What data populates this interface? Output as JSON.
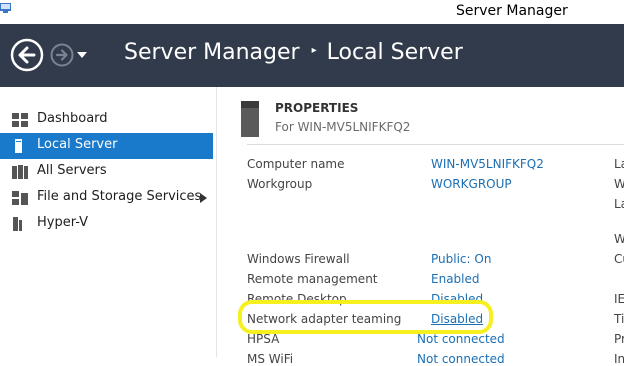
{
  "window": {
    "title": "Server Manager"
  },
  "header": {
    "breadcrumb_root": "Server Manager",
    "breadcrumb_separator": "▸",
    "breadcrumb_current": "Local Server"
  },
  "sidebar": {
    "items": [
      {
        "label": "Dashboard",
        "icon": "dashboard-icon"
      },
      {
        "label": "Local Server",
        "icon": "local-server-icon",
        "active": true
      },
      {
        "label": "All Servers",
        "icon": "all-servers-icon"
      },
      {
        "label": "File and Storage Services",
        "icon": "file-storage-icon",
        "has_submenu": true
      },
      {
        "label": "Hyper-V",
        "icon": "hyper-v-icon"
      }
    ]
  },
  "properties": {
    "title": "PROPERTIES",
    "subtitle": "For WIN-MV5LNIFKFQ2",
    "rows": [
      {
        "label": "Computer name",
        "value": "WIN-MV5LNIFKFQ2"
      },
      {
        "label": "Workgroup",
        "value": "WORKGROUP"
      },
      {
        "label": "Windows Firewall",
        "value": "Public: On"
      },
      {
        "label": "Remote management",
        "value": "Enabled"
      },
      {
        "label": "Remote Desktop",
        "value": "Disabled"
      },
      {
        "label": "Network adapter teaming",
        "value": "Disabled"
      },
      {
        "label": "HPSA",
        "value": "Not connected"
      },
      {
        "label": "MS WiFi",
        "value": "Not connected"
      }
    ],
    "right_column_partial": [
      "La",
      "W",
      "La",
      "W",
      "Cu",
      "IE",
      "Ti",
      "Pr",
      "In"
    ]
  },
  "colors": {
    "header_bg": "#323b4b",
    "active_nav": "#1979ca",
    "link": "#1b6fb5",
    "highlight": "#f5f01e"
  }
}
